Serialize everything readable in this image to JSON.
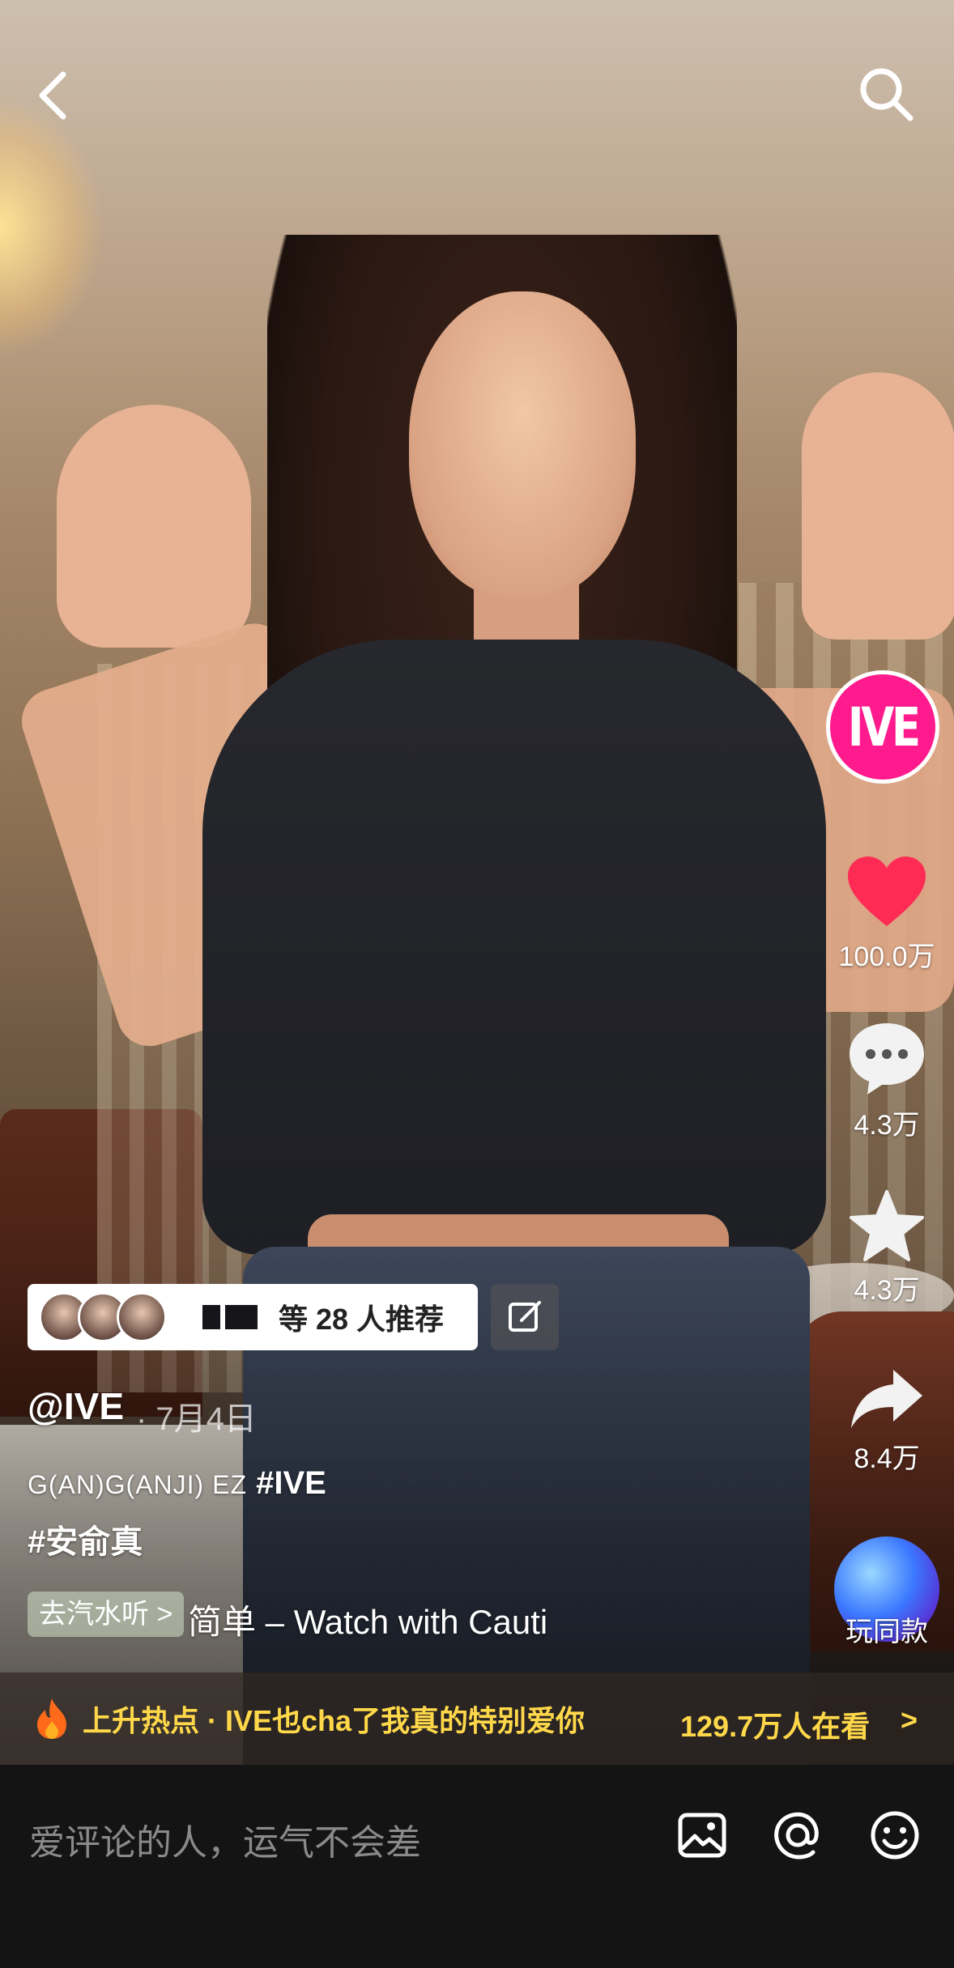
{
  "video": {
    "description_tags": []
  },
  "topbar": {
    "back_icon": "chevron-left-icon",
    "search_icon": "search-icon"
  },
  "actions": {
    "avatar_text": "IVE",
    "avatar_color": "#ff1b8d",
    "likes": "100.0万",
    "comments": "4.3万",
    "favorites": "4.3万",
    "shares": "8.4万",
    "same_label": "玩同款",
    "like_color": "#fe2c55"
  },
  "recommend": {
    "text": "等 28 人推荐"
  },
  "post": {
    "username": "@IVE",
    "date": "· 7月4日",
    "caption_small": "G(AN)G(ANJI) EZ",
    "caption_tag1": "#IVE",
    "caption_tag2": "#安俞真",
    "music_button": "去汽水听 >",
    "music_title": "简单 – Watch with Cauti"
  },
  "hot": {
    "text": "上升热点 · IVE也cha了我真的特别爱你",
    "watching": "129.7万人在看",
    "arrow": ">",
    "color": "#ffd84a"
  },
  "comment_bar": {
    "placeholder": "爱评论的人，运气不会差"
  }
}
